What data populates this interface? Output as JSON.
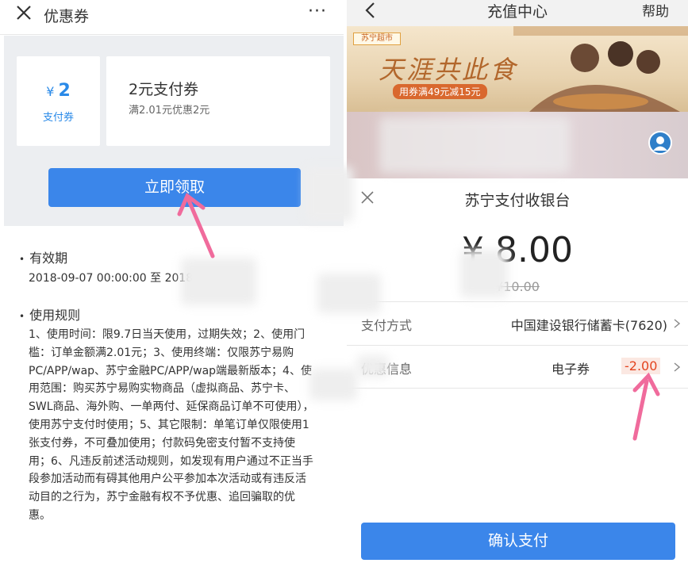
{
  "left": {
    "header": {
      "title": "优惠券",
      "more_glyph": "···"
    },
    "coupon": {
      "currency": "¥",
      "amount": "2",
      "type": "支付券",
      "name": "2元支付券",
      "condition": "满2.01元优惠2元"
    },
    "claim_button": "立即领取",
    "validity": {
      "title": "有效期",
      "range": "2018-09-07 00:00:00 至 2018-0                 .59"
    },
    "rules": {
      "title": "使用规则",
      "text": "1、使用时间：限9.7日当天使用，过期失效；2、使用门槛：订单金额满2.01元；3、使用终端：仅限苏宁易购PC/APP/wap、苏宁金融PC/APP/wap端最新版本；4、使用范围：购买苏宁易购实物商品（虚拟商品、苏宁卡、SWL商品、海外购、一单两付、延保商品订单不可使用），使用苏宁支付时使用；5、其它限制：单笔订单仅限使用1张支付券，不可叠加使用；付款码免密支付暂不支持使用；6、凡违反前述活动规则，如发现有用户通过不正当手段参加活动而有碍其他用户公平参加本次活动或有违反活动目的之行为，苏宁金融有权不予优惠、追回骗取的优惠。"
    }
  },
  "right": {
    "header": {
      "title": "充值中心",
      "help": "帮助"
    },
    "banner": {
      "logo": "苏宁超市",
      "slogan": "天涯共此食",
      "promo": "用券满49元减15元"
    },
    "cashier": {
      "title": "苏宁支付收银台",
      "amount": "¥ 8.00",
      "original_amount": "¥10.00",
      "payment_method_label": "支付方式",
      "payment_method_value": "中国建设银行储蓄卡(7620)",
      "discount_label": "优惠信息",
      "discount_kind": "电子券",
      "discount_value": "-2.00",
      "confirm_button": "确认支付"
    }
  },
  "colors": {
    "primary": "#3b86ea",
    "coupon_blue": "#2a8ae8",
    "discount_red": "#e3441f",
    "arrow_pink": "#f06b9c"
  }
}
